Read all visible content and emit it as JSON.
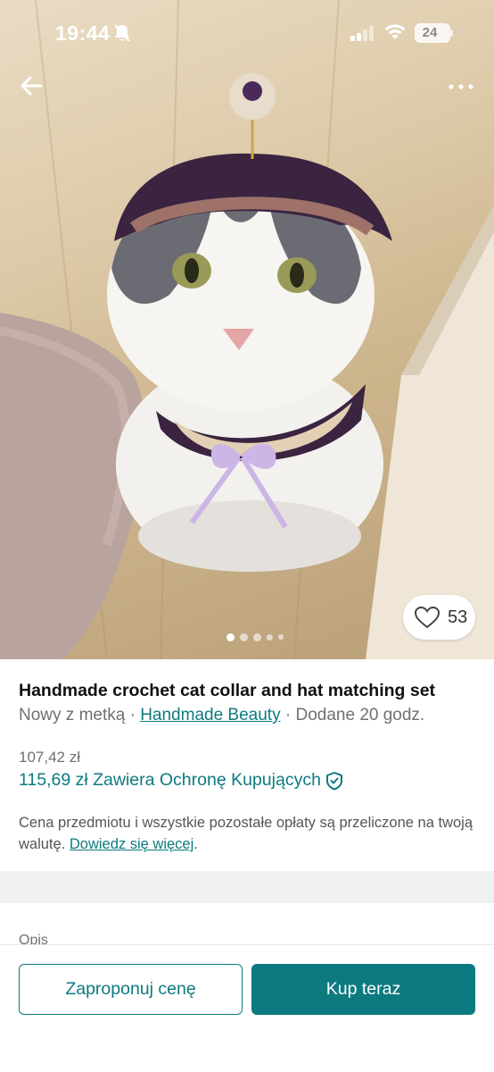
{
  "status_bar": {
    "time": "19:44",
    "battery": "24"
  },
  "photo": {
    "subject_image": "cat-wearing-crochet-hat-and-collar-photo",
    "page_dots": 5,
    "active_dot": 0,
    "favorites_count": "53"
  },
  "nav": {
    "back_icon": "arrow-left-icon",
    "more_icon": "more-horizontal-icon"
  },
  "listing": {
    "title": "Handmade crochet cat collar and hat matching set",
    "condition": "Nowy z metką",
    "separator": " · ",
    "brand": "Handmade Beauty",
    "added": "Dodane 20 godz.",
    "price": "107,42 zł",
    "price_with_protection": "115,69 zł Zawiera Ochronę Kupujących",
    "note_text": "Cena przedmiotu i wszystkie pozostałe opłaty są przeliczone na twoją walutę. ",
    "note_link": "Dowiedz się więcej",
    "note_end": "."
  },
  "section": {
    "description_label": "Opis"
  },
  "actions": {
    "offer_label": "Zaproponuj cenę",
    "buy_label": "Kup teraz"
  },
  "colors": {
    "accent": "#0d7a80",
    "muted_text": "#707070",
    "divider": "#eef0f1"
  }
}
